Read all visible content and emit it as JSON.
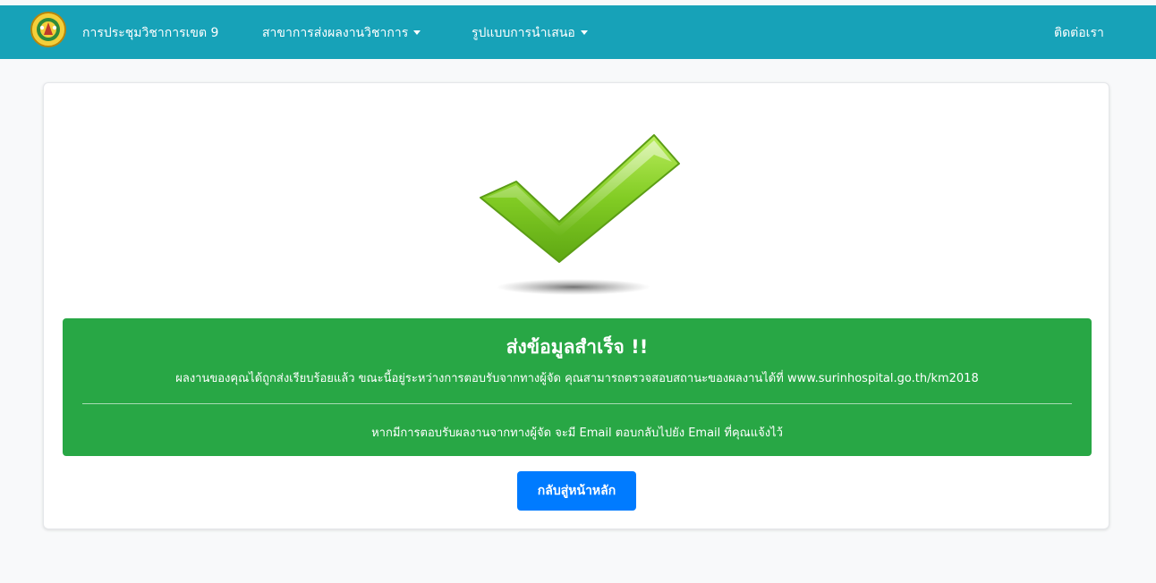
{
  "navbar": {
    "brand": "การประชุมวิชาการเขต 9",
    "menu_branches": "สาขาการส่งผลงานวิชาการ",
    "menu_formats": "รูปแบบการนำเสนอ",
    "contact": "ติดต่อเรา",
    "logo_icon": "organization-seal-logo",
    "color": "#17a2b8"
  },
  "success": {
    "icon": "checkmark-icon",
    "heading": "ส่งข้อมูลสำเร็จ !!",
    "message": "ผลงานของคุณได้ถูกส่งเรียบร้อยแล้ว ขณะนี้อยู่ระหว่างการตอบรับจากทางผู้จัด คุณสามารถตรวจสอบสถานะของผลงานได้ที่ www.surinhospital.go.th/km2018",
    "note": "หากมีการตอบรับผลงานจากทางผู้จัด จะมี Email ตอบกลับไปยัง Email ที่คุณแจ้งไว้",
    "alert_color": "#28a745"
  },
  "actions": {
    "home_button": "กลับสู่หน้าหลัก",
    "button_color": "#007bff"
  }
}
